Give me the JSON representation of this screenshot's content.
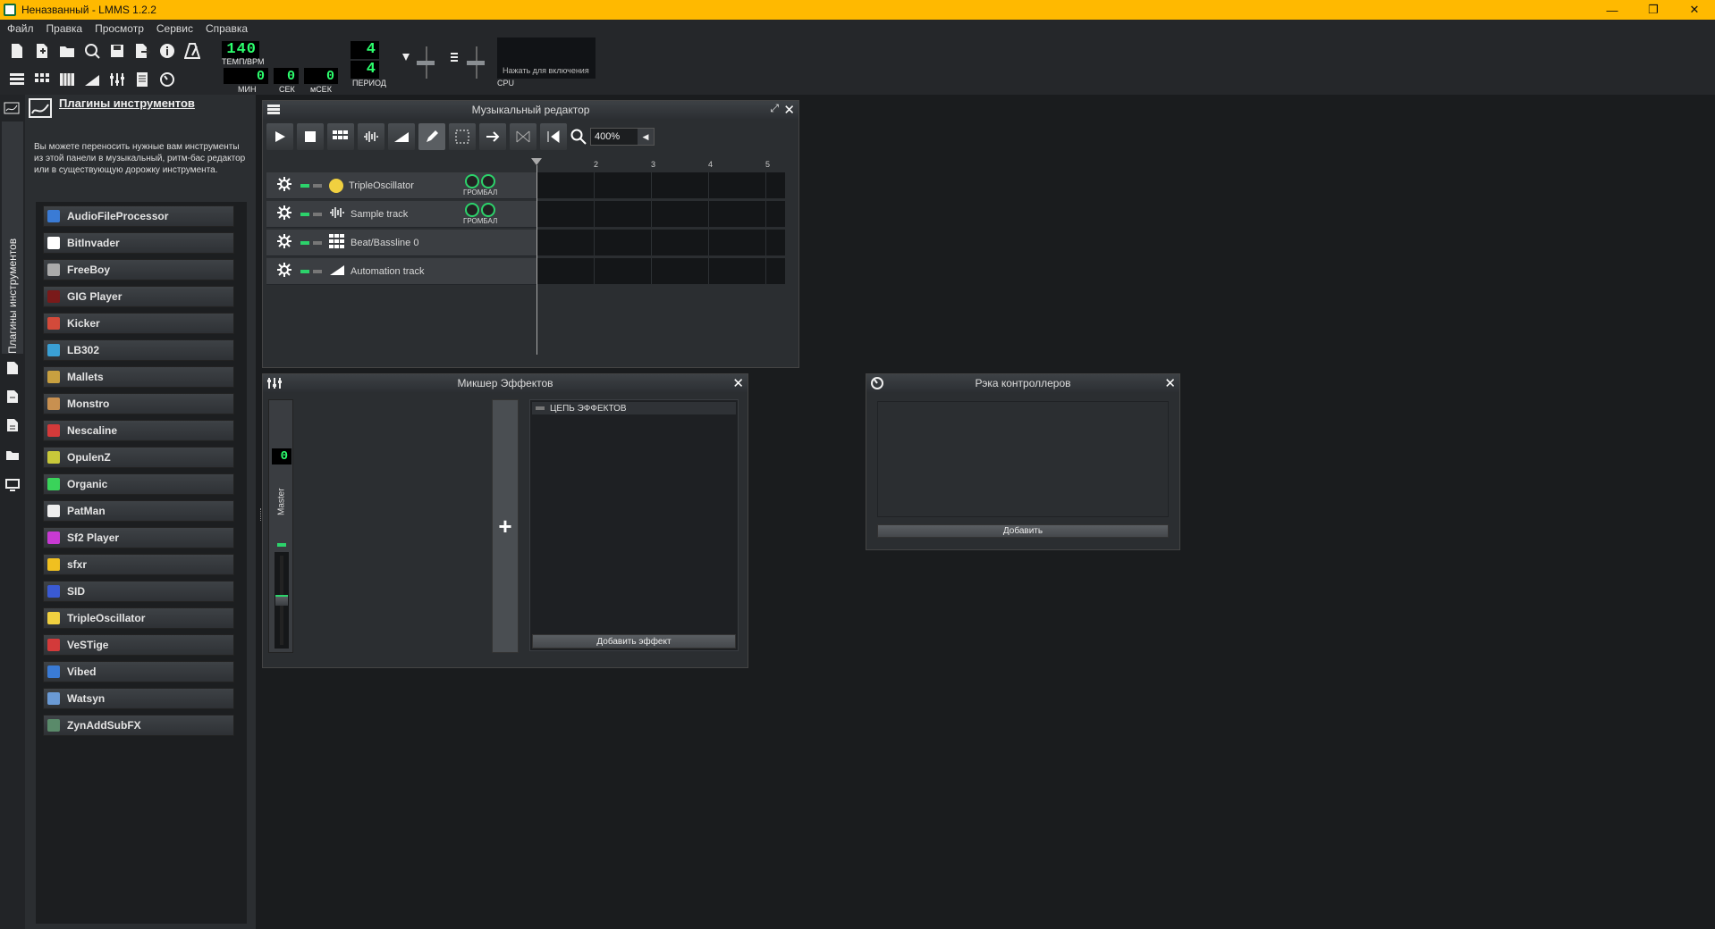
{
  "window": {
    "title": "Неназванный - LMMS 1.2.2",
    "min": "—",
    "max": "❐",
    "close": "✕"
  },
  "menu": [
    "Файл",
    "Правка",
    "Просмотр",
    "Сервис",
    "Справка"
  ],
  "toolbar": {
    "tempo": "140",
    "tempo_label": "ТЕМП/BPM",
    "min": "0",
    "min_label": "МИН",
    "sec": "0",
    "sec_label": "СЕК",
    "msec": "0",
    "msec_label": "мСЕК",
    "sig_num": "4",
    "sig_den": "4",
    "period_label": "ПЕРИОД",
    "cpu_hint": "Нажать для включения",
    "cpu_label": "CPU"
  },
  "sidebar": {
    "vertical_tab": "Плагины инструментов",
    "title": "Плагины инструментов",
    "description": "Вы можете переносить нужные вам инструменты из этой панели в музыкальный, ритм-бас редактор или в существующую дорожку инструмента.",
    "plugins": [
      {
        "label": "AudioFileProcessor",
        "color": "#3a7bd5"
      },
      {
        "label": "BitInvader",
        "color": "#ffffff"
      },
      {
        "label": "FreeBoy",
        "color": "#aaaaaa"
      },
      {
        "label": "GIG Player",
        "color": "#7a1a1a"
      },
      {
        "label": "Kicker",
        "color": "#d34a3a"
      },
      {
        "label": "LB302",
        "color": "#3aa0d5"
      },
      {
        "label": "Mallets",
        "color": "#c8a040"
      },
      {
        "label": "Monstro",
        "color": "#c89050"
      },
      {
        "label": "Nescaline",
        "color": "#d33a3a"
      },
      {
        "label": "OpulenZ",
        "color": "#c8c83a"
      },
      {
        "label": "Organic",
        "color": "#3ad35a"
      },
      {
        "label": "PatMan",
        "color": "#eeeeee"
      },
      {
        "label": "Sf2 Player",
        "color": "#c83ad3"
      },
      {
        "label": "sfxr",
        "color": "#f0c020"
      },
      {
        "label": "SID",
        "color": "#3a5ad3"
      },
      {
        "label": "TripleOscillator",
        "color": "#f0d040"
      },
      {
        "label": "VeSTige",
        "color": "#d33a3a"
      },
      {
        "label": "Vibed",
        "color": "#3a7bd5"
      },
      {
        "label": "Watsyn",
        "color": "#6a9ad5"
      },
      {
        "label": "ZynAddSubFX",
        "color": "#5a8a6a"
      }
    ]
  },
  "song_editor": {
    "title": "Музыкальный редактор",
    "zoom": "400%",
    "bars": [
      "2",
      "3",
      "4",
      "5"
    ],
    "knob_label": "ГРОМБАЛ",
    "tracks": [
      {
        "name": "TripleOscillator"
      },
      {
        "name": "Sample track"
      },
      {
        "name": "Beat/Bassline 0"
      },
      {
        "name": "Automation track"
      }
    ]
  },
  "mixer": {
    "title": "Микшер Эффектов",
    "master_label": "Master",
    "channel_number": "0",
    "add_channel": "+",
    "chain_label": "ЦЕПЬ ЭФФЕКТОВ",
    "add_effect": "Добавить эффект"
  },
  "controllers": {
    "title": "Рэка контроллеров",
    "add": "Добавить"
  }
}
